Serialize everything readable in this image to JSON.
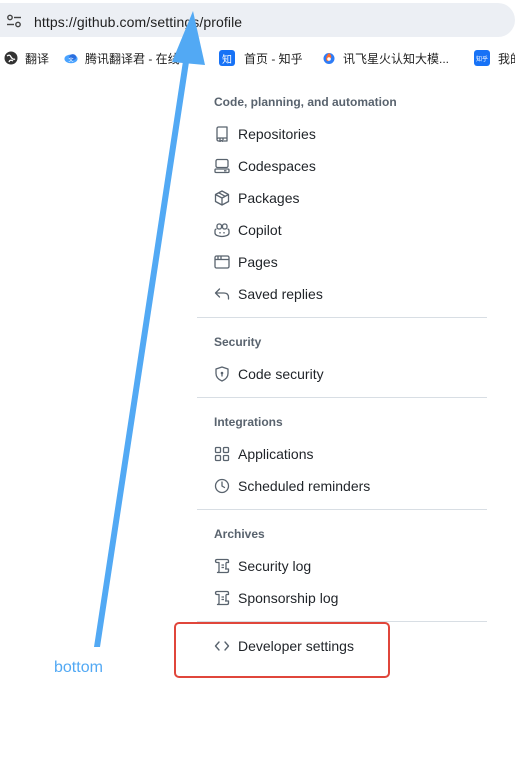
{
  "browser": {
    "url": "https://github.com/settings/profile",
    "bookmarks": [
      {
        "label": "翻译",
        "icon": "globe-icon"
      },
      {
        "label": "腾讯翻译君 - 在线",
        "icon": "tencent-translate-icon"
      },
      {
        "label": "首页 - 知乎",
        "icon": "zhihu-icon",
        "icon_text": "知"
      },
      {
        "label": "讯飞星火认知大模...",
        "icon": "iflytek-spark-icon"
      },
      {
        "label": "我的",
        "icon": "zhihu-small-icon",
        "icon_text": "知乎"
      }
    ]
  },
  "menu": {
    "sections": {
      "code": {
        "title": "Code, planning, and automation",
        "items": [
          {
            "label": "Repositories",
            "icon": "repo-icon"
          },
          {
            "label": "Codespaces",
            "icon": "codespaces-icon"
          },
          {
            "label": "Packages",
            "icon": "package-icon"
          },
          {
            "label": "Copilot",
            "icon": "copilot-icon"
          },
          {
            "label": "Pages",
            "icon": "browser-icon"
          },
          {
            "label": "Saved replies",
            "icon": "reply-icon"
          }
        ]
      },
      "security": {
        "title": "Security",
        "items": [
          {
            "label": "Code security",
            "icon": "shield-icon"
          }
        ]
      },
      "integrations": {
        "title": "Integrations",
        "items": [
          {
            "label": "Applications",
            "icon": "apps-icon"
          },
          {
            "label": "Scheduled reminders",
            "icon": "clock-icon"
          }
        ]
      },
      "archives": {
        "title": "Archives",
        "items": [
          {
            "label": "Security log",
            "icon": "log-icon"
          },
          {
            "label": "Sponsorship log",
            "icon": "log-icon"
          }
        ]
      }
    },
    "developer": {
      "label": "Developer settings",
      "icon": "code-icon"
    }
  },
  "annotation": {
    "label": "bottom",
    "arrow_color": "#52a9f4",
    "highlight_color": "#e0463b"
  }
}
